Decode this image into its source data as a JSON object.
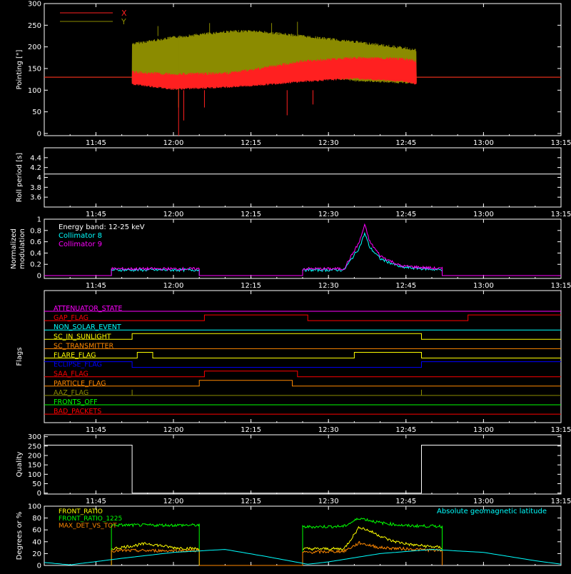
{
  "time_axis": {
    "start": "11:35",
    "end": "13:15",
    "tick_labels": [
      "11:45",
      "12:00",
      "12:15",
      "12:30",
      "12:45",
      "13:00",
      "13:15"
    ]
  },
  "colors": {
    "background": "#000000",
    "axes": "#ffffff",
    "x_pointing": "#ff2020",
    "y_pointing": "#8b8b00",
    "white": "#ffffff",
    "cyan": "#00ffff",
    "magenta": "#ff00ff",
    "yellow": "#ffff00",
    "green": "#00ff00",
    "orange": "#ff8800",
    "blue": "#0000ff",
    "red": "#ff0000"
  },
  "chart_data": [
    {
      "type": "line",
      "ylabel": "Pointing [\"]",
      "ylim": [
        -5,
        300
      ],
      "yticks": [
        0,
        50,
        100,
        150,
        200,
        250,
        300
      ],
      "legend_placement": "top-left",
      "series": [
        {
          "name": "X",
          "color": "#ff2020",
          "segments": [
            {
              "t": [
                "11:35",
                "11:52",
                "11:52",
                "12:47",
                "12:47",
                "13:15"
              ],
              "low": [
                null,
                null,
                130,
                115,
                null,
                null
              ],
              "high": [
                null,
                null,
                140,
                210,
                null,
                null
              ]
            }
          ],
          "envelope": {
            "t": [
              "11:52",
              "12:00",
              "12:10",
              "12:15",
              "12:25",
              "12:35",
              "12:45",
              "12:47"
            ],
            "low": [
              112,
              100,
              105,
              108,
              118,
              125,
              118,
              112
            ],
            "high": [
              145,
              140,
              142,
              150,
              170,
              178,
              175,
              170
            ]
          },
          "spikes": [
            {
              "t": "12:01",
              "v": -5
            },
            {
              "t": "12:02",
              "v": 30
            },
            {
              "t": "12:06",
              "v": 60
            },
            {
              "t": "12:22",
              "v": 42
            },
            {
              "t": "12:27",
              "v": 67
            }
          ],
          "baseline": 130
        },
        {
          "name": "Y",
          "color": "#8b8b00",
          "envelope": {
            "t": [
              "11:52",
              "12:00",
              "12:10",
              "12:15",
              "12:25",
              "12:35",
              "12:45",
              "12:47"
            ],
            "low": [
              118,
              118,
              120,
              125,
              135,
              120,
              115,
              115
            ],
            "high": [
              210,
              225,
              238,
              240,
              228,
              215,
              200,
              195
            ]
          },
          "spikes": [
            {
              "t": "11:57",
              "v": 248
            },
            {
              "t": "12:07",
              "v": 255
            },
            {
              "t": "12:19",
              "v": 255
            },
            {
              "t": "12:24",
              "v": 258
            },
            {
              "t": "12:01",
              "v": 60
            }
          ],
          "baseline": 130
        }
      ]
    },
    {
      "type": "line",
      "ylabel": "Roll period [s]",
      "ylim": [
        3.4,
        4.6
      ],
      "yticks": [
        3.6,
        3.8,
        4.0,
        4.2,
        4.4
      ],
      "series": [
        {
          "color": "#ffffff",
          "t": [
            "11:35",
            "13:15"
          ],
          "y": [
            4.07,
            4.07
          ]
        }
      ]
    },
    {
      "type": "line",
      "ylabel": "Normalized modulation",
      "ylim": [
        -0.05,
        1.0
      ],
      "yticks": [
        0.0,
        0.2,
        0.4,
        0.6,
        0.8,
        1.0
      ],
      "legend_placement": "top-left",
      "legend_title": "Energy band: 12-25 keV",
      "series": [
        {
          "name": "Collimator 8",
          "color": "#00ffff",
          "t": [
            "11:35",
            "11:48",
            "11:48",
            "12:05",
            "12:05",
            "12:25",
            "12:25",
            "12:33",
            "12:36",
            "12:37",
            "12:38",
            "12:40",
            "12:44",
            "12:52",
            "12:52",
            "13:15"
          ],
          "y": [
            0,
            0,
            0.1,
            0.1,
            0,
            0,
            0.1,
            0.1,
            0.5,
            0.75,
            0.5,
            0.3,
            0.15,
            0.1,
            0,
            0
          ]
        },
        {
          "name": "Collimator 9",
          "color": "#ff00ff",
          "t": [
            "11:35",
            "11:48",
            "11:48",
            "12:05",
            "12:05",
            "12:25",
            "12:25",
            "12:33",
            "12:36",
            "12:37",
            "12:38",
            "12:40",
            "12:44",
            "12:52",
            "12:52",
            "13:15"
          ],
          "y": [
            0,
            0,
            0.12,
            0.12,
            0,
            0,
            0.12,
            0.12,
            0.6,
            0.9,
            0.6,
            0.35,
            0.17,
            0.12,
            0,
            0
          ]
        }
      ]
    },
    {
      "type": "line",
      "ylabel": "Flags",
      "series": [
        {
          "name": "ATTENUATOR_STATE",
          "color": "#ff00ff",
          "t": [
            "11:35",
            "13:15"
          ],
          "state": [
            0,
            0
          ]
        },
        {
          "name": "GAP_FLAG",
          "color": "#ff0000",
          "t": [
            "11:35",
            "12:06",
            "12:26",
            "12:57",
            "13:15"
          ],
          "state": [
            0,
            1,
            0,
            1,
            1
          ]
        },
        {
          "name": "NON_SOLAR_EVENT",
          "color": "#00ffff",
          "t": [
            "11:35",
            "13:15"
          ],
          "state": [
            0,
            0
          ]
        },
        {
          "name": "SC_IN_SUNLIGHT",
          "color": "#ffff00",
          "t": [
            "11:35",
            "11:52",
            "12:48",
            "13:15"
          ],
          "state": [
            0,
            1,
            0,
            0
          ]
        },
        {
          "name": "SC_TRANSMITTER",
          "color": "#ff8800",
          "t": [
            "11:35",
            "13:15"
          ],
          "state": [
            0,
            0
          ]
        },
        {
          "name": "FLARE_FLAG",
          "color": "#ffff00",
          "t": [
            "11:35",
            "11:53",
            "11:56",
            "12:35",
            "12:48",
            "13:15"
          ],
          "state": [
            0,
            1,
            0,
            1,
            0,
            0
          ]
        },
        {
          "name": "ECLIPSE_FLAG",
          "color": "#0000ff",
          "t": [
            "11:35",
            "11:52",
            "12:48",
            "13:15"
          ],
          "state": [
            1,
            0,
            1,
            1
          ]
        },
        {
          "name": "SAA_FLAG",
          "color": "#ff0000",
          "t": [
            "11:35",
            "12:06",
            "12:24",
            "13:15"
          ],
          "state": [
            0,
            1,
            0,
            0
          ]
        },
        {
          "name": "PARTICLE_FLAG",
          "color": "#ff8800",
          "t": [
            "11:35",
            "12:05",
            "12:23",
            "13:15"
          ],
          "state": [
            0,
            1,
            0,
            0
          ]
        },
        {
          "name": "AAZ_FLAG",
          "color": "#8b8b00",
          "t": [
            "11:35",
            "11:52",
            "11:52",
            "12:48",
            "12:48",
            "13:15"
          ],
          "state": [
            0,
            1,
            0,
            1,
            0,
            0
          ]
        },
        {
          "name": "FRONTS_OFF",
          "color": "#00ff00",
          "t": [
            "11:35",
            "13:15"
          ],
          "state": [
            0,
            0
          ]
        },
        {
          "name": "BAD_PACKETS",
          "color": "#ff0000",
          "t": [
            "11:35",
            "13:15"
          ],
          "state": [
            0,
            0
          ]
        }
      ]
    },
    {
      "type": "line",
      "ylabel": "Quality",
      "ylim": [
        -5,
        310
      ],
      "yticks": [
        0,
        50,
        100,
        150,
        200,
        250,
        300
      ],
      "series": [
        {
          "color": "#ffffff",
          "t": [
            "11:35",
            "11:52",
            "11:52",
            "12:48",
            "12:48",
            "13:15"
          ],
          "y": [
            255,
            255,
            0,
            0,
            255,
            255
          ]
        }
      ]
    },
    {
      "type": "line",
      "ylabel": "Degrees or %",
      "ylim": [
        0,
        100
      ],
      "yticks": [
        0,
        20,
        40,
        60,
        80,
        100
      ],
      "legend_placement": "top-left",
      "series": [
        {
          "name": "FRONT_RATIO",
          "color": "#ffff00",
          "t": [
            "11:48",
            "11:48",
            "11:55",
            "12:00",
            "12:05",
            "12:05",
            "12:25",
            "12:25",
            "12:33",
            "12:36",
            "12:38",
            "12:42",
            "12:46",
            "12:52",
            "12:52"
          ],
          "y": [
            0,
            28,
            37,
            30,
            28,
            0,
            0,
            28,
            28,
            65,
            58,
            42,
            35,
            30,
            0
          ]
        },
        {
          "name": "FRONT_RATIO_1225",
          "color": "#00ff00",
          "t": [
            "11:48",
            "11:48",
            "12:05",
            "12:05",
            "12:25",
            "12:25",
            "12:33",
            "12:36",
            "12:40",
            "12:45",
            "12:52",
            "12:52"
          ],
          "y": [
            0,
            68,
            68,
            0,
            0,
            65,
            66,
            80,
            72,
            67,
            66,
            0
          ]
        },
        {
          "name": "MAX_DET_VS_TOT",
          "color": "#ff8800",
          "t": [
            "11:48",
            "11:48",
            "12:05",
            "12:05",
            "12:25",
            "12:25",
            "12:33",
            "12:36",
            "12:40",
            "12:52",
            "12:52"
          ],
          "y": [
            0,
            25,
            25,
            0,
            0,
            22,
            24,
            38,
            30,
            25,
            0
          ]
        },
        {
          "name": "Absolute geomagnetic latitude",
          "color": "#00ffff",
          "t": [
            "11:35",
            "11:40",
            "11:50",
            "12:00",
            "12:10",
            "12:18",
            "12:26",
            "12:30",
            "12:40",
            "12:50",
            "13:00",
            "13:10",
            "13:15"
          ],
          "y": [
            5,
            1,
            12,
            22,
            27,
            15,
            2,
            6,
            20,
            27,
            22,
            8,
            2
          ]
        }
      ]
    }
  ]
}
